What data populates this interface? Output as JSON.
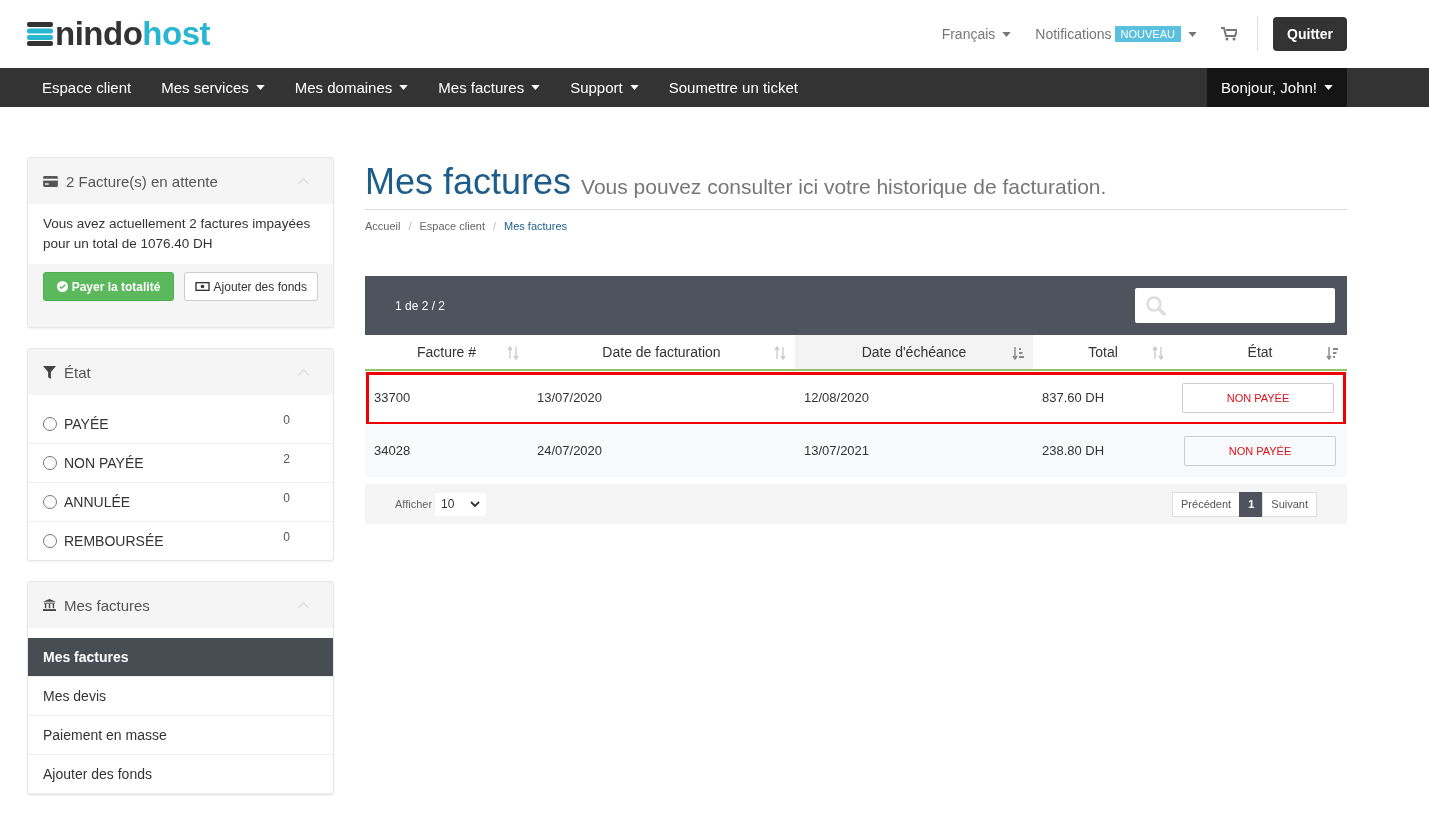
{
  "header": {
    "logo": {
      "part_1": "nindo",
      "part_2": "host"
    },
    "language": "Français",
    "notifications": {
      "label": "Notifications",
      "badge": "NOUVEAU"
    },
    "logout": "Quitter"
  },
  "nav": {
    "items": [
      {
        "label": "Espace client",
        "dropdown": false
      },
      {
        "label": "Mes services",
        "dropdown": true
      },
      {
        "label": "Mes domaines",
        "dropdown": true
      },
      {
        "label": "Mes factures",
        "dropdown": true
      },
      {
        "label": "Support",
        "dropdown": true
      },
      {
        "label": "Soumettre un ticket",
        "dropdown": false
      }
    ],
    "user": "Bonjour, John!"
  },
  "sidebar": {
    "pending": {
      "title": "2 Facture(s) en attente",
      "text": "Vous avez actuellement 2 factures impayées pour un total de 1076.40 DH",
      "pay_all": "Payer la totalité",
      "add_funds": "Ajouter des fonds"
    },
    "status_filter": {
      "title": "État",
      "options": [
        {
          "label": "PAYÉE",
          "count": "0",
          "selected": false
        },
        {
          "label": "NON PAYÉE",
          "count": "2",
          "selected": false
        },
        {
          "label": "ANNULÉE",
          "count": "0",
          "selected": false
        },
        {
          "label": "REMBOURSÉE",
          "count": "0",
          "selected": false
        }
      ]
    },
    "menu": {
      "title": "Mes factures",
      "items": [
        {
          "label": "Mes factures",
          "selected": true
        },
        {
          "label": "Mes devis",
          "selected": false
        },
        {
          "label": "Paiement en masse",
          "selected": false
        },
        {
          "label": "Ajouter des fonds",
          "selected": false
        }
      ]
    }
  },
  "page": {
    "title": "Mes factures",
    "subtitle": "Vous pouvez consulter ici votre historique de facturation.",
    "breadcrumb": [
      {
        "label": "Accueil",
        "current": false
      },
      {
        "separator": "/",
        "label": "Espace client",
        "current": false
      },
      {
        "separator": "/",
        "label": "Mes factures",
        "current": true
      }
    ]
  },
  "table": {
    "info": "1 de 2 / 2",
    "columns": [
      {
        "label": "Facture #",
        "kind": "unsorted",
        "selected": false
      },
      {
        "label": "Date de facturation",
        "kind": "unsorted",
        "selected": false
      },
      {
        "label": "Date d'échéance",
        "kind": "ascending",
        "selected": true
      },
      {
        "label": "Total",
        "kind": "unsorted",
        "selected": false
      },
      {
        "label": "État",
        "kind": "descending",
        "selected": false
      }
    ],
    "rows": [
      {
        "invoice": "33700",
        "date": "13/07/2020",
        "due": "12/08/2020",
        "total": "837.60 DH",
        "status": "NON PAYÉE",
        "highlighted": true
      },
      {
        "invoice": "34028",
        "date": "24/07/2020",
        "due": "13/07/2021",
        "total": "238.80 DH",
        "status": "NON PAYÉE",
        "highlighted": false
      }
    ],
    "show_label": "Afficher",
    "page_size": "10",
    "prev": "Précédent",
    "pages": [
      {
        "label": "1",
        "selected": true
      }
    ],
    "next": "Suivant"
  }
}
